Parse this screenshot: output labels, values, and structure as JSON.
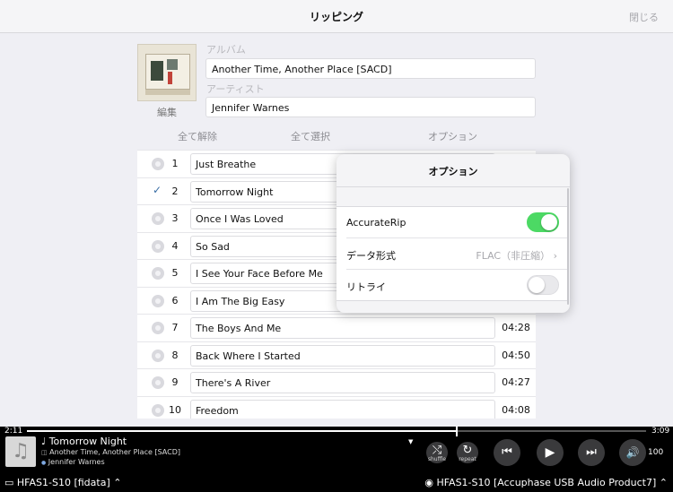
{
  "header": {
    "title": "リッピング",
    "close_label": "閉じる"
  },
  "album_info": {
    "edit_label": "編集",
    "album_label": "アルバム",
    "album_value": "Another Time, Another Place [SACD]",
    "artist_label": "アーティスト",
    "artist_value": "Jennifer Warnes"
  },
  "actions": {
    "deselect_all": "全て解除",
    "select_all": "全て選択",
    "options": "オプション"
  },
  "tracks": [
    {
      "num": "1",
      "title": "Just Breathe",
      "duration": "",
      "checked": false
    },
    {
      "num": "2",
      "title": "Tomorrow Night",
      "duration": "",
      "checked": true
    },
    {
      "num": "3",
      "title": "Once I Was Loved",
      "duration": "",
      "checked": false
    },
    {
      "num": "4",
      "title": "So Sad",
      "duration": "",
      "checked": false
    },
    {
      "num": "5",
      "title": "I See Your Face Before Me",
      "duration": "",
      "checked": false
    },
    {
      "num": "6",
      "title": "I Am The Big Easy",
      "duration": "",
      "checked": false
    },
    {
      "num": "7",
      "title": "The Boys And Me",
      "duration": "04:28",
      "checked": false
    },
    {
      "num": "8",
      "title": "Back Where I Started",
      "duration": "04:50",
      "checked": false
    },
    {
      "num": "9",
      "title": "There's A River",
      "duration": "04:27",
      "checked": false
    },
    {
      "num": "10",
      "title": "Freedom",
      "duration": "04:08",
      "checked": false
    }
  ],
  "options_popover": {
    "title": "オプション",
    "accuraterip_label": "AccurateRip",
    "accuraterip_on": true,
    "format_label": "データ形式",
    "format_value": "FLAC（非圧縮） ›",
    "retry_label": "リトライ",
    "retry_on": false
  },
  "player": {
    "elapsed": "2:11",
    "total": "3:09",
    "progress_fraction": 0.693,
    "title": "Tomorrow Night",
    "album": "Another Time, Another Place [SACD]",
    "artist": "Jennifer Warnes",
    "shuffle_label": "shuffle",
    "repeat_label": "repeat",
    "volume": "100",
    "device_left": "HFAS1-S10 [fidata]",
    "device_right": "HFAS1-S10 [Accuphase USB Audio Product7]"
  },
  "icons": {
    "note": "♩",
    "music": "♫",
    "album_glyph": "◫",
    "artist_glyph": "●",
    "shuffle": "⤭",
    "repeat": "↻",
    "prev": "⏮",
    "play": "▶",
    "next": "⏭",
    "volume": "🔊",
    "chevron_up": "⌃",
    "monitor": "▭",
    "speaker_device": "◉"
  }
}
